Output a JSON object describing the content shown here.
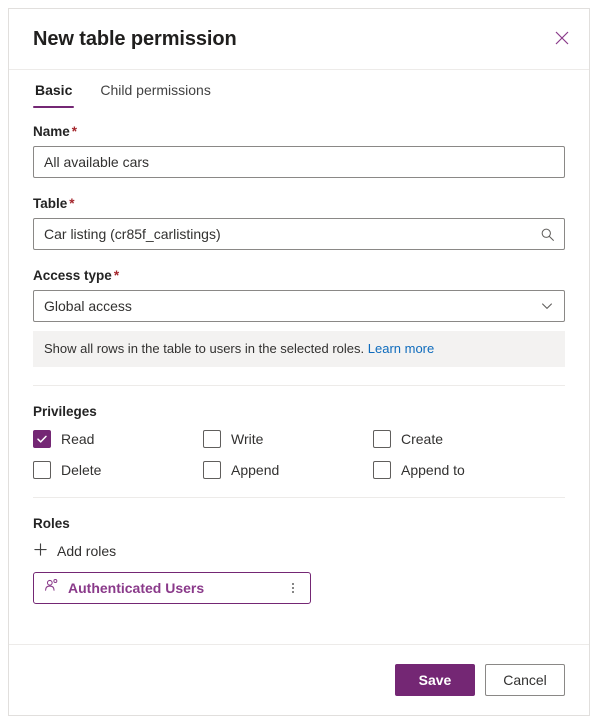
{
  "dialog": {
    "title": "New table permission",
    "close_icon": "close-icon",
    "accent_color": "#742774",
    "link_color": "#0f6cbd",
    "required_marker": "*"
  },
  "tabs": [
    {
      "label": "Basic",
      "active": true
    },
    {
      "label": "Child permissions",
      "active": false
    }
  ],
  "fields": {
    "name": {
      "label": "Name",
      "required": true,
      "value": "All available cars",
      "placeholder": "Name"
    },
    "table": {
      "label": "Table",
      "required": true,
      "value": "Car listing (cr85f_carlistings)",
      "placeholder": "Search tables",
      "icon": "search-icon"
    },
    "access_type": {
      "label": "Access type",
      "required": true,
      "value": "Global access",
      "icon": "chevron-down-icon",
      "options": [
        "Global access"
      ],
      "hint_text": "Show all rows in the table to users in the selected roles.",
      "hint_link": "Learn more"
    }
  },
  "privileges": {
    "title": "Privileges",
    "items": [
      {
        "label": "Read",
        "checked": true
      },
      {
        "label": "Write",
        "checked": false
      },
      {
        "label": "Create",
        "checked": false
      },
      {
        "label": "Delete",
        "checked": false
      },
      {
        "label": "Append",
        "checked": false
      },
      {
        "label": "Append to",
        "checked": false
      }
    ]
  },
  "roles": {
    "title": "Roles",
    "add_label": "Add roles",
    "add_icon": "plus-icon",
    "chips": [
      {
        "name": "Authenticated Users",
        "icon": "person-icon",
        "menu_icon": "more-vertical-icon"
      }
    ]
  },
  "footer": {
    "save_label": "Save",
    "cancel_label": "Cancel"
  }
}
